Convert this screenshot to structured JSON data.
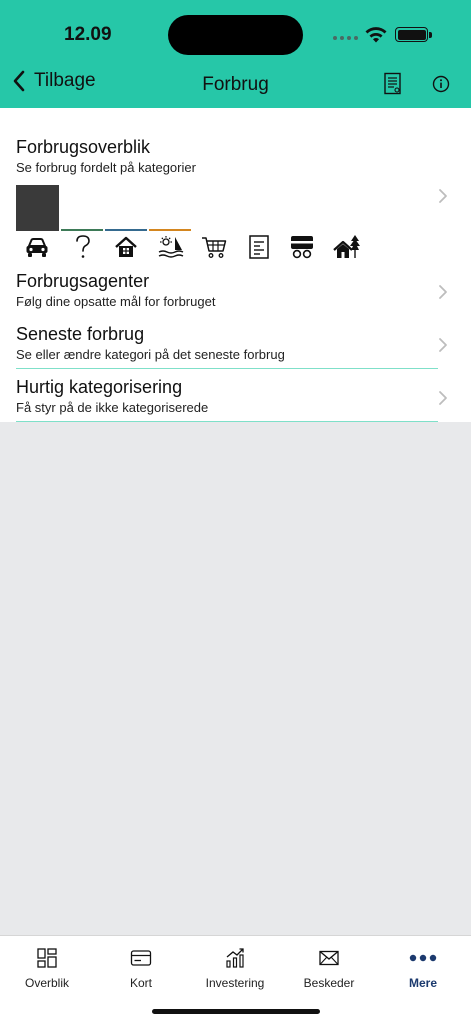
{
  "status": {
    "time": "12.09"
  },
  "header": {
    "back_label": "Tilbage",
    "title": "Forbrug"
  },
  "rows": [
    {
      "title": "Forbrugsoverblik",
      "subtitle": "Se forbrug fordelt på kategorier"
    },
    {
      "title": "Forbrugsagenter",
      "subtitle": "Følg dine opsatte mål for forbruget"
    },
    {
      "title": "Seneste forbrug",
      "subtitle": "Se eller ændre kategori på det seneste forbrug"
    },
    {
      "title": "Hurtig kategorisering",
      "subtitle": "Få styr på de ikke kategoriserede"
    }
  ],
  "categories": [
    "car-icon",
    "question-mark-icon",
    "house-icon",
    "leisure-icon",
    "shopping-cart-icon",
    "document-icon",
    "vehicle-icon",
    "cabin-icon"
  ],
  "category_colors": [
    "#3a3a3a",
    "#3d7a57",
    "#356a8f",
    "#d4861f"
  ],
  "tabs": [
    {
      "label": "Overblik",
      "icon": "grid-icon"
    },
    {
      "label": "Kort",
      "icon": "card-icon"
    },
    {
      "label": "Investering",
      "icon": "chart-icon"
    },
    {
      "label": "Beskeder",
      "icon": "envelope-icon"
    },
    {
      "label": "Mere",
      "icon": "more-icon",
      "active": true
    }
  ],
  "colors": {
    "brand": "#26c7a8",
    "active_tab": "#1c3a6e",
    "divider": "#7fe0c9"
  }
}
